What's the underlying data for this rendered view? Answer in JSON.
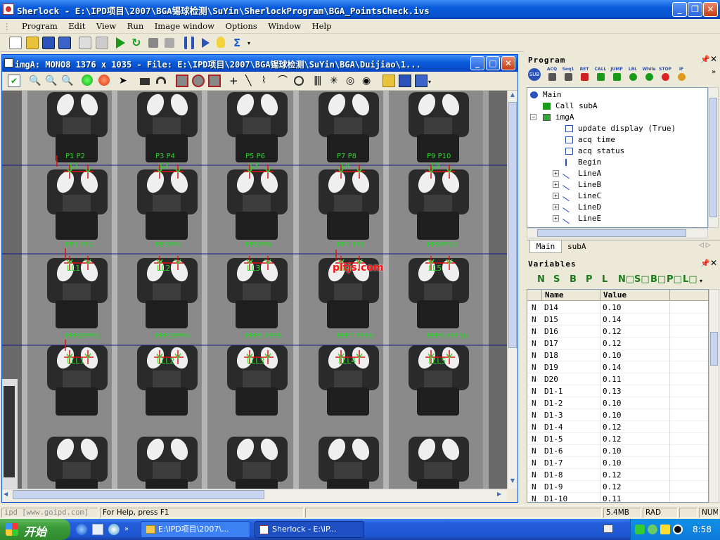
{
  "app": {
    "title": "Sherlock - E:\\IPD项目\\2007\\BGA锡球检测\\SuYin\\SherlockProgram\\BGA_PointsCheck.ivs"
  },
  "menu": [
    "Program",
    "Edit",
    "View",
    "Run",
    "Image window",
    "Options",
    "Window",
    "Help"
  ],
  "image_window": {
    "title": "imgA: MONO8 1376 x 1035 - File: E:\\IPD项目\\2007\\BGA锡球检测\\SuYin\\BGA\\Duijiao\\1...",
    "watermark": "pltjs.com"
  },
  "overlay": {
    "row1_labels": [
      "L1",
      "L2",
      "L3",
      "L4",
      "L5"
    ],
    "row1_top": [
      "P1 P2",
      "P3 P4",
      "P5 P6",
      "P7 P8",
      "P9 P10"
    ],
    "row2_labels": [
      "LL1",
      "LL2",
      "LL3",
      "LL4",
      "LL5"
    ],
    "row2_top": [
      "PP1 PP2",
      "PP3PP4",
      "PP5PP6",
      "PP7 PP8",
      "PP9PP10"
    ],
    "row3_labels": [
      "LLL1",
      "LLL2",
      "LLL3",
      "LLL4",
      "LLL5"
    ],
    "row3_top": [
      "PPP1PPP2",
      "PPP3PPP4",
      "PPP5 PPP6",
      "PPP7 PPP8",
      "PPP9 PPP10"
    ]
  },
  "program_panel": {
    "title": "Program",
    "tools": [
      "ACQ",
      "Seq1",
      "RET",
      "CALL",
      "JUMP",
      "LBL",
      "While",
      "STOP",
      "IF"
    ],
    "tree": [
      {
        "label": "Main",
        "indent": 0,
        "icon": "sub"
      },
      {
        "label": "Call subA",
        "indent": 1,
        "icon": "call"
      },
      {
        "label": "imgA",
        "indent": 1,
        "icon": "image"
      },
      {
        "label": "update display (True)",
        "indent": 2,
        "icon": "b"
      },
      {
        "label": "acq time",
        "indent": 2,
        "icon": "n"
      },
      {
        "label": "acq status",
        "indent": 2,
        "icon": "b"
      },
      {
        "label": "Begin",
        "indent": 2,
        "icon": "brace"
      },
      {
        "label": "LineA",
        "indent": 2,
        "icon": "line"
      },
      {
        "label": "LineB",
        "indent": 2,
        "icon": "line"
      },
      {
        "label": "LineC",
        "indent": 2,
        "icon": "line"
      },
      {
        "label": "LineD",
        "indent": 2,
        "icon": "line"
      },
      {
        "label": "LineE",
        "indent": 2,
        "icon": "line"
      }
    ],
    "tabs": [
      "Main",
      "subA"
    ]
  },
  "variables_panel": {
    "title": "Variables",
    "type_filters": [
      "N",
      "S",
      "B",
      "P",
      "L",
      "N□",
      "S□",
      "B□",
      "P□",
      "L□"
    ],
    "columns": [
      "Name",
      "Value"
    ],
    "rows": [
      {
        "type": "N",
        "name": "D14",
        "value": "0.10"
      },
      {
        "type": "N",
        "name": "D15",
        "value": "0.14"
      },
      {
        "type": "N",
        "name": "D16",
        "value": "0.12"
      },
      {
        "type": "N",
        "name": "D17",
        "value": "0.12"
      },
      {
        "type": "N",
        "name": "D18",
        "value": "0.10"
      },
      {
        "type": "N",
        "name": "D19",
        "value": "0.14"
      },
      {
        "type": "N",
        "name": "D20",
        "value": "0.11"
      },
      {
        "type": "N",
        "name": "D1-1",
        "value": "0.13"
      },
      {
        "type": "N",
        "name": "D1-2",
        "value": "0.10"
      },
      {
        "type": "N",
        "name": "D1-3",
        "value": "0.10"
      },
      {
        "type": "N",
        "name": "D1-4",
        "value": "0.12"
      },
      {
        "type": "N",
        "name": "D1-5",
        "value": "0.12"
      },
      {
        "type": "N",
        "name": "D1-6",
        "value": "0.10"
      },
      {
        "type": "N",
        "name": "D1-7",
        "value": "0.10"
      },
      {
        "type": "N",
        "name": "D1-8",
        "value": "0.12"
      },
      {
        "type": "N",
        "name": "D1-9",
        "value": "0.12"
      },
      {
        "type": "N",
        "name": "D1-10",
        "value": "0.11"
      }
    ]
  },
  "status": {
    "left": "ipd [www.goipd.com]",
    "help": "For Help, press F1",
    "memory": "5.4MB",
    "rad": "RAD",
    "num": "NUM"
  },
  "taskbar": {
    "start": "开始",
    "tasks": [
      "E:\\IPD项目\\2007\\...",
      "Sherlock - E:\\IP..."
    ],
    "clock": "8:58"
  },
  "colors": {
    "overlay_green": "#2fd12f",
    "overlay_red": "#e01010",
    "scanline": "#1a1a8c",
    "watermark": "#ff1010"
  }
}
